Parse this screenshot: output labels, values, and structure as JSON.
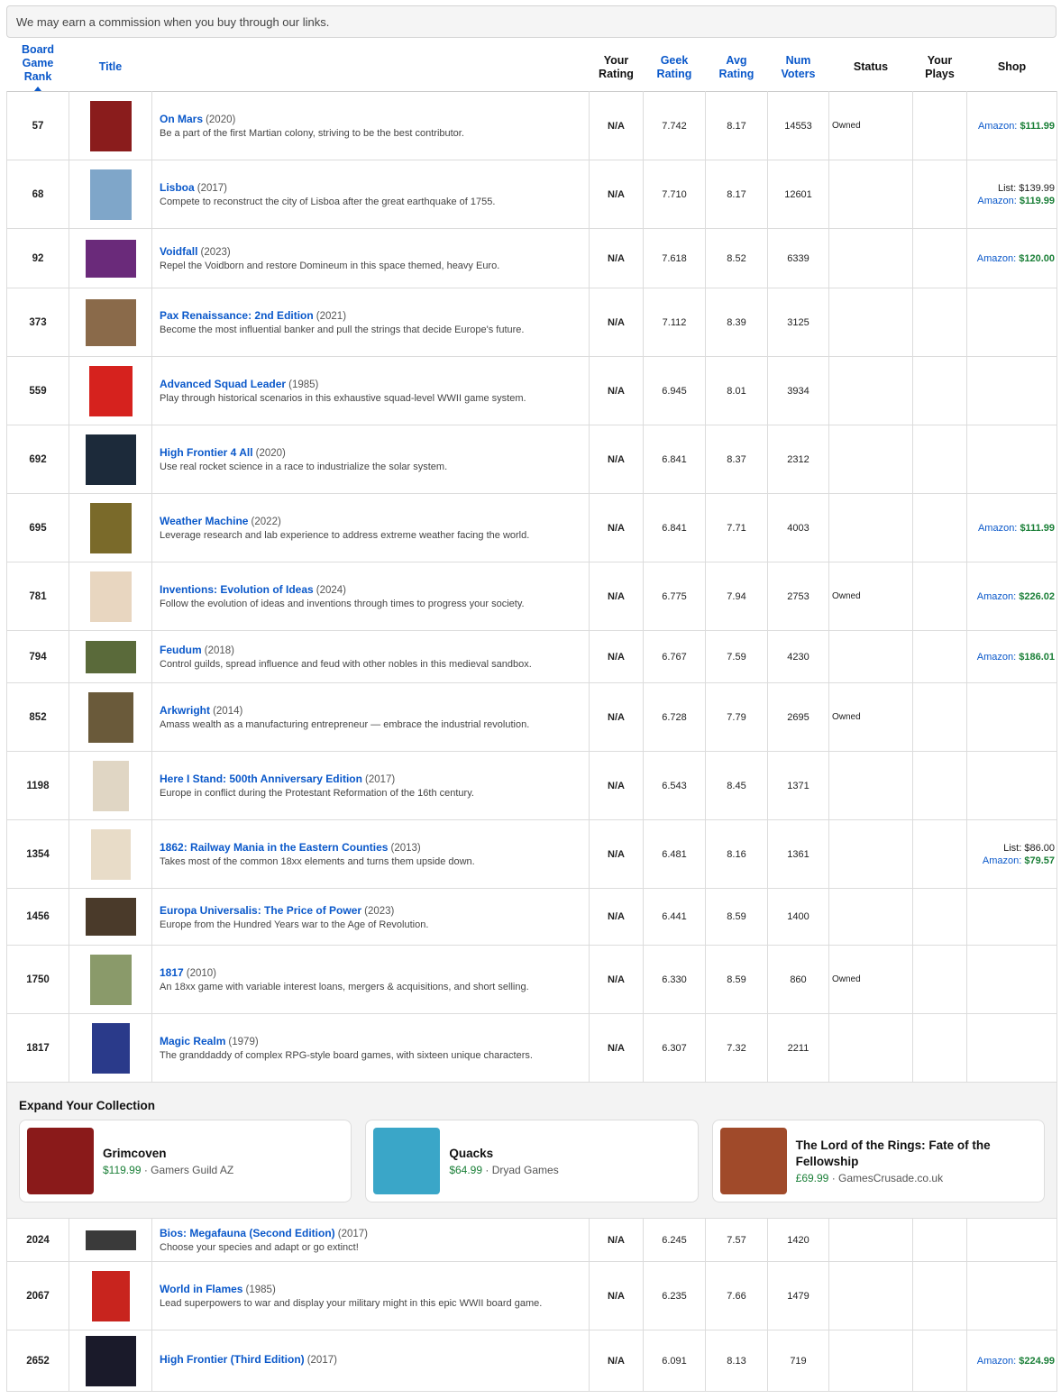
{
  "notice": "We may earn a commission when you buy through our links.",
  "headers": {
    "rank": "Board Game Rank",
    "title": "Title",
    "your_rating": "Your Rating",
    "geek_rating": "Geek Rating",
    "avg_rating": "Avg Rating",
    "num_voters": "Num Voters",
    "status": "Status",
    "your_plays": "Your Plays",
    "shop": "Shop"
  },
  "rows": [
    {
      "rank": "57",
      "name": "On Mars",
      "year": "(2020)",
      "desc": "Be a part of the first Martian colony, striving to be the best contributor.",
      "your_rating": "N/A",
      "geek": "7.742",
      "avg": "8.17",
      "voters": "14553",
      "status": "Owned",
      "list": "",
      "amazon_label": "Amazon:",
      "amazon_price": "$111.99",
      "cover": "#8a1c1c"
    },
    {
      "rank": "68",
      "name": "Lisboa",
      "year": "(2017)",
      "desc": "Compete to reconstruct the city of Lisboa after the great earthquake of 1755.",
      "your_rating": "N/A",
      "geek": "7.710",
      "avg": "8.17",
      "voters": "12601",
      "status": "",
      "list": "List: $139.99",
      "amazon_label": "Amazon:",
      "amazon_price": "$119.99",
      "cover": "#7fa6c9"
    },
    {
      "rank": "92",
      "name": "Voidfall",
      "year": "(2023)",
      "desc": "Repel the Voidborn and restore Domineum in this space themed, heavy Euro.",
      "your_rating": "N/A",
      "geek": "7.618",
      "avg": "8.52",
      "voters": "6339",
      "status": "",
      "list": "",
      "amazon_label": "Amazon:",
      "amazon_price": "$120.00",
      "cover": "#6a2a7a"
    },
    {
      "rank": "373",
      "name": "Pax Renaissance: 2nd Edition",
      "year": "(2021)",
      "desc": "Become the most influential banker and pull the strings that decide Europe's future.",
      "your_rating": "N/A",
      "geek": "7.112",
      "avg": "8.39",
      "voters": "3125",
      "status": "",
      "list": "",
      "amazon_label": "",
      "amazon_price": "",
      "cover": "#8a6a4a"
    },
    {
      "rank": "559",
      "name": "Advanced Squad Leader",
      "year": "(1985)",
      "desc": "Play through historical scenarios in this exhaustive squad-level WWII game system.",
      "your_rating": "N/A",
      "geek": "6.945",
      "avg": "8.01",
      "voters": "3934",
      "status": "",
      "list": "",
      "amazon_label": "",
      "amazon_price": "",
      "cover": "#d6221e"
    },
    {
      "rank": "692",
      "name": "High Frontier 4 All",
      "year": "(2020)",
      "desc": "Use real rocket science in a race to industrialize the solar system.",
      "your_rating": "N/A",
      "geek": "6.841",
      "avg": "8.37",
      "voters": "2312",
      "status": "",
      "list": "",
      "amazon_label": "",
      "amazon_price": "",
      "cover": "#1c2a3a"
    },
    {
      "rank": "695",
      "name": "Weather Machine",
      "year": "(2022)",
      "desc": "Leverage research and lab experience to address extreme weather facing the world.",
      "your_rating": "N/A",
      "geek": "6.841",
      "avg": "7.71",
      "voters": "4003",
      "status": "",
      "list": "",
      "amazon_label": "Amazon:",
      "amazon_price": "$111.99",
      "cover": "#7a6a2a"
    },
    {
      "rank": "781",
      "name": "Inventions: Evolution of Ideas",
      "year": "(2024)",
      "desc": "Follow the evolution of ideas and inventions through times to progress your society.",
      "your_rating": "N/A",
      "geek": "6.775",
      "avg": "7.94",
      "voters": "2753",
      "status": "Owned",
      "list": "",
      "amazon_label": "Amazon:",
      "amazon_price": "$226.02",
      "cover": "#e8d6c0"
    },
    {
      "rank": "794",
      "name": "Feudum",
      "year": "(2018)",
      "desc": "Control guilds, spread influence and feud with other nobles in this medieval sandbox.",
      "your_rating": "N/A",
      "geek": "6.767",
      "avg": "7.59",
      "voters": "4230",
      "status": "",
      "list": "",
      "amazon_label": "Amazon:",
      "amazon_price": "$186.01",
      "cover": "#5a6a3a"
    },
    {
      "rank": "852",
      "name": "Arkwright",
      "year": "(2014)",
      "desc": "Amass wealth as a manufacturing entrepreneur — embrace the industrial revolution.",
      "your_rating": "N/A",
      "geek": "6.728",
      "avg": "7.79",
      "voters": "2695",
      "status": "Owned",
      "list": "",
      "amazon_label": "",
      "amazon_price": "",
      "cover": "#6a5a3a"
    },
    {
      "rank": "1198",
      "name": "Here I Stand: 500th Anniversary Edition",
      "year": "(2017)",
      "desc": "Europe in conflict during the Protestant Reformation of the 16th century.",
      "your_rating": "N/A",
      "geek": "6.543",
      "avg": "8.45",
      "voters": "1371",
      "status": "",
      "list": "",
      "amazon_label": "",
      "amazon_price": "",
      "cover": "#e0d6c4"
    },
    {
      "rank": "1354",
      "name": "1862: Railway Mania in the Eastern Counties",
      "year": "(2013)",
      "desc": "Takes most of the common 18xx elements and turns them upside down.",
      "your_rating": "N/A",
      "geek": "6.481",
      "avg": "8.16",
      "voters": "1361",
      "status": "",
      "list": "List: $86.00",
      "amazon_label": "Amazon:",
      "amazon_price": "$79.57",
      "cover": "#e8dcc8"
    },
    {
      "rank": "1456",
      "name": "Europa Universalis: The Price of Power",
      "year": "(2023)",
      "desc": "Europe from the Hundred Years war to the Age of Revolution.",
      "your_rating": "N/A",
      "geek": "6.441",
      "avg": "8.59",
      "voters": "1400",
      "status": "",
      "list": "",
      "amazon_label": "",
      "amazon_price": "",
      "cover": "#4a3a2a"
    },
    {
      "rank": "1750",
      "name": "1817",
      "year": "(2010)",
      "desc": "An 18xx game with variable interest loans, mergers & acquisitions, and short selling.",
      "your_rating": "N/A",
      "geek": "6.330",
      "avg": "8.59",
      "voters": "860",
      "status": "Owned",
      "list": "",
      "amazon_label": "",
      "amazon_price": "",
      "cover": "#8a9a6a"
    },
    {
      "rank": "1817",
      "name": "Magic Realm",
      "year": "(1979)",
      "desc": "The granddaddy of complex RPG-style board games, with sixteen unique characters.",
      "your_rating": "N/A",
      "geek": "6.307",
      "avg": "7.32",
      "voters": "2211",
      "status": "",
      "list": "",
      "amazon_label": "",
      "amazon_price": "",
      "cover": "#2a3a8a"
    }
  ],
  "expand": {
    "title": "Expand Your Collection",
    "cards": [
      {
        "name": "Grimcoven",
        "price": "$119.99",
        "seller": "Gamers Guild AZ",
        "color": "#8a1a1a"
      },
      {
        "name": "Quacks",
        "price": "$64.99",
        "seller": "Dryad Games",
        "color": "#3aa6c8"
      },
      {
        "name": "The Lord of the Rings: Fate of the Fellowship",
        "price": "£69.99",
        "seller": "GamesCrusade.co.uk",
        "color": "#a04a2a"
      }
    ]
  },
  "rows2": [
    {
      "rank": "2024",
      "name": "Bios: Megafauna (Second Edition)",
      "year": "(2017)",
      "desc": "Choose your species and adapt or go extinct!",
      "your_rating": "N/A",
      "geek": "6.245",
      "avg": "7.57",
      "voters": "1420",
      "status": "",
      "list": "",
      "amazon_label": "",
      "amazon_price": "",
      "cover": "#3a3a3a"
    },
    {
      "rank": "2067",
      "name": "World in Flames",
      "year": "(1985)",
      "desc": "Lead superpowers to war and display your military might in this epic WWII board game.",
      "your_rating": "N/A",
      "geek": "6.235",
      "avg": "7.66",
      "voters": "1479",
      "status": "",
      "list": "",
      "amazon_label": "",
      "amazon_price": "",
      "cover": "#c8241e"
    },
    {
      "rank": "2652",
      "name": "High Frontier (Third Edition)",
      "year": "(2017)",
      "desc": "",
      "your_rating": "N/A",
      "geek": "6.091",
      "avg": "8.13",
      "voters": "719",
      "status": "",
      "list": "",
      "amazon_label": "Amazon:",
      "amazon_price": "$224.99",
      "cover": "#1a1a2a"
    }
  ]
}
